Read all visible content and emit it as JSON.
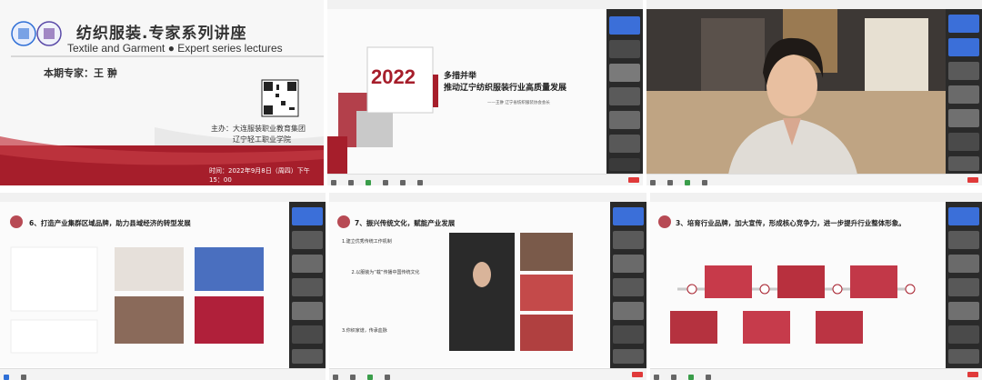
{
  "panel1": {
    "title": "纺织服装.专家系列讲座",
    "subtitle": "Textile and Garment ● Expert series lectures",
    "expert": "本期专家：王 翀",
    "host_line1": "主办：大连服装职业教育集团",
    "host_line2": "辽宁轻工职业学院",
    "time": "时间：2022年9月8日（周四）下午15：00"
  },
  "panel2": {
    "year": "2022",
    "slide_title_line1": "多措并举",
    "slide_title_line2": "推动辽宁纺织服装行业高质量发展",
    "presenter": "——王翀  辽宁省纺织服装协会会长"
  },
  "panel4": {
    "slide_title": "6、打造产业集群区域品牌，助力县域经济的转型发展"
  },
  "panel5": {
    "slide_title": "7、振兴传统文化，赋能产业发展",
    "section1": "1.建立优秀传统工作机制",
    "section2": "2.以服装为“载”传播中国传统文化",
    "section3": "3.你织家谱，传承血脉"
  },
  "panel6": {
    "slide_title": "3、培育行业品牌，加大宣传，形成核心竞争力，进一步提升行业整体形象。"
  },
  "colors": {
    "brand_red": "#a61e2b",
    "dark": "#2a2a2a",
    "accent_blue": "#2f6fd6"
  }
}
